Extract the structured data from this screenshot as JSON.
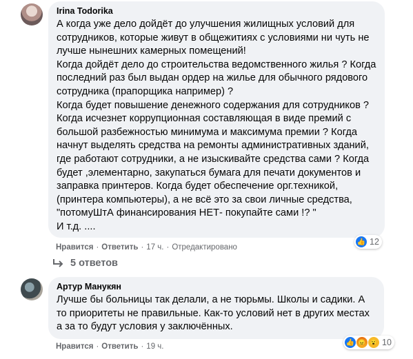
{
  "comments": [
    {
      "author": "Irina Todorika",
      "lines": [
        "А когда уже дело дойдёт до улучшения жилищных условий для",
        "сотрудников, которые живут в общежитиях с условиями ни чуть не",
        "лучше нынешних камерных помещений!",
        "Когда дойдёт дело до строительства ведомственного жилья ? Когда",
        "последний раз был выдан ордер на жилье для обычного рядового",
        "сотрудника (прапорщика например) ?",
        "Когда будет повышение денежного содержания для сотрудников ?",
        "Когда исчезнет коррупционная составляющая в виде премий с",
        "большой разбежностью минимума и максимума премии ? Когда",
        "начнут выделять средства на ремонты административных зданий,",
        "где работают сотрудники, а не изыскивайте средства сами ? Когда",
        "будет ,элементарно, закупаться бумага для печати документов и",
        "заправка принтеров. Когда будет обеспечение орг.техникой,",
        "(принтера компьютеры), а не всё это за свои личные средства,",
        "\"потомуШтА финансирования НЕТ- покупайте сами !? \"",
        "И т.д. ...."
      ],
      "like_label": "Нравится",
      "reply_label": "Ответить",
      "time": "17 ч.",
      "edited": "Отредактировано",
      "reaction_count": "12"
    },
    {
      "author": "Артур Манукян",
      "lines": [
        "Лучше бы больницы так делали, а не тюрьмы. Школы и садики. А",
        "то приоритеты не правильные. Как-то условий нет в других местах",
        "а за то будут условия у заключённых."
      ],
      "like_label": "Нравится",
      "reply_label": "Ответить",
      "time": "19 ч.",
      "reaction_count": "10"
    }
  ],
  "replies_label": "5 ответов",
  "icons": {
    "like": "like-icon",
    "angry": "angry-icon",
    "wow": "wow-icon",
    "reply_arrow": "reply-arrow-icon"
  },
  "colors": {
    "bubble": "#f0f2f5",
    "meta_text": "#65676b",
    "like_blue": "#1877f2"
  }
}
